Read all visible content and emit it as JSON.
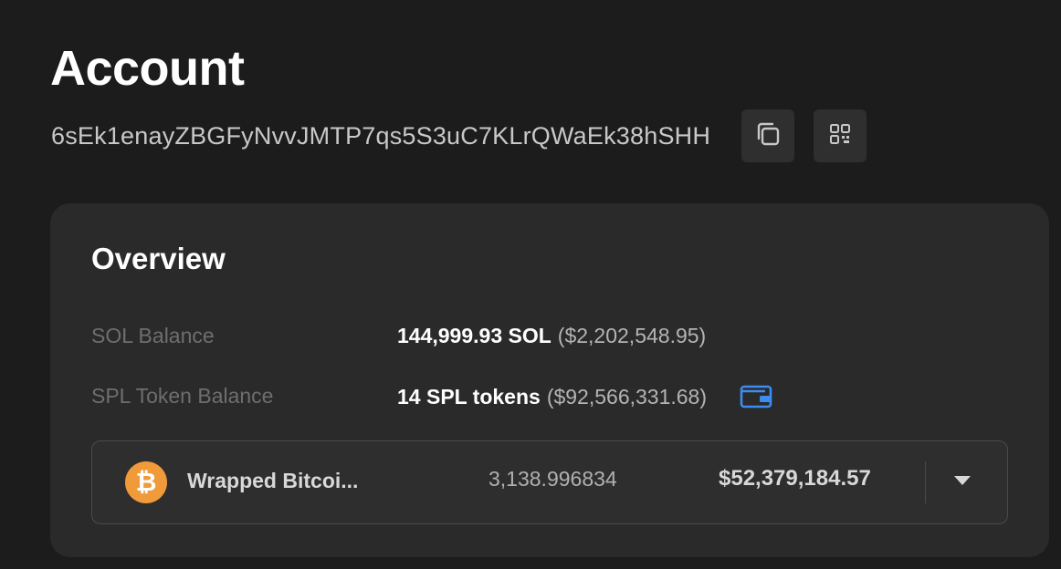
{
  "page": {
    "title": "Account",
    "address": "6sEk1enayZBGFyNvvJMTP7qs5S3uC7KLrQWaEk38hSHH",
    "actions": {
      "copy_icon": "copy-icon",
      "qr_icon": "qr-code-icon"
    }
  },
  "overview": {
    "title": "Overview",
    "sol_balance": {
      "label": "SOL Balance",
      "amount": "144,999.93 SOL",
      "usd": "($2,202,548.95)"
    },
    "spl_balance": {
      "label": "SPL Token Balance",
      "amount": "14 SPL tokens",
      "usd": "($92,566,331.68)",
      "icon": "wallet-icon"
    },
    "selected_token": {
      "logo_glyph": "₿",
      "name": "Wrapped Bitcoi...",
      "amount": "3,138.996834",
      "usd": "$52,379,184.57",
      "expand_icon": "chevron-down-icon"
    }
  },
  "colors": {
    "background": "#1c1c1c",
    "card": "#2a2a2a",
    "button": "#2f2f2f",
    "accent_blue": "#3d8cf0",
    "bitcoin_orange": "#f09a3a"
  }
}
